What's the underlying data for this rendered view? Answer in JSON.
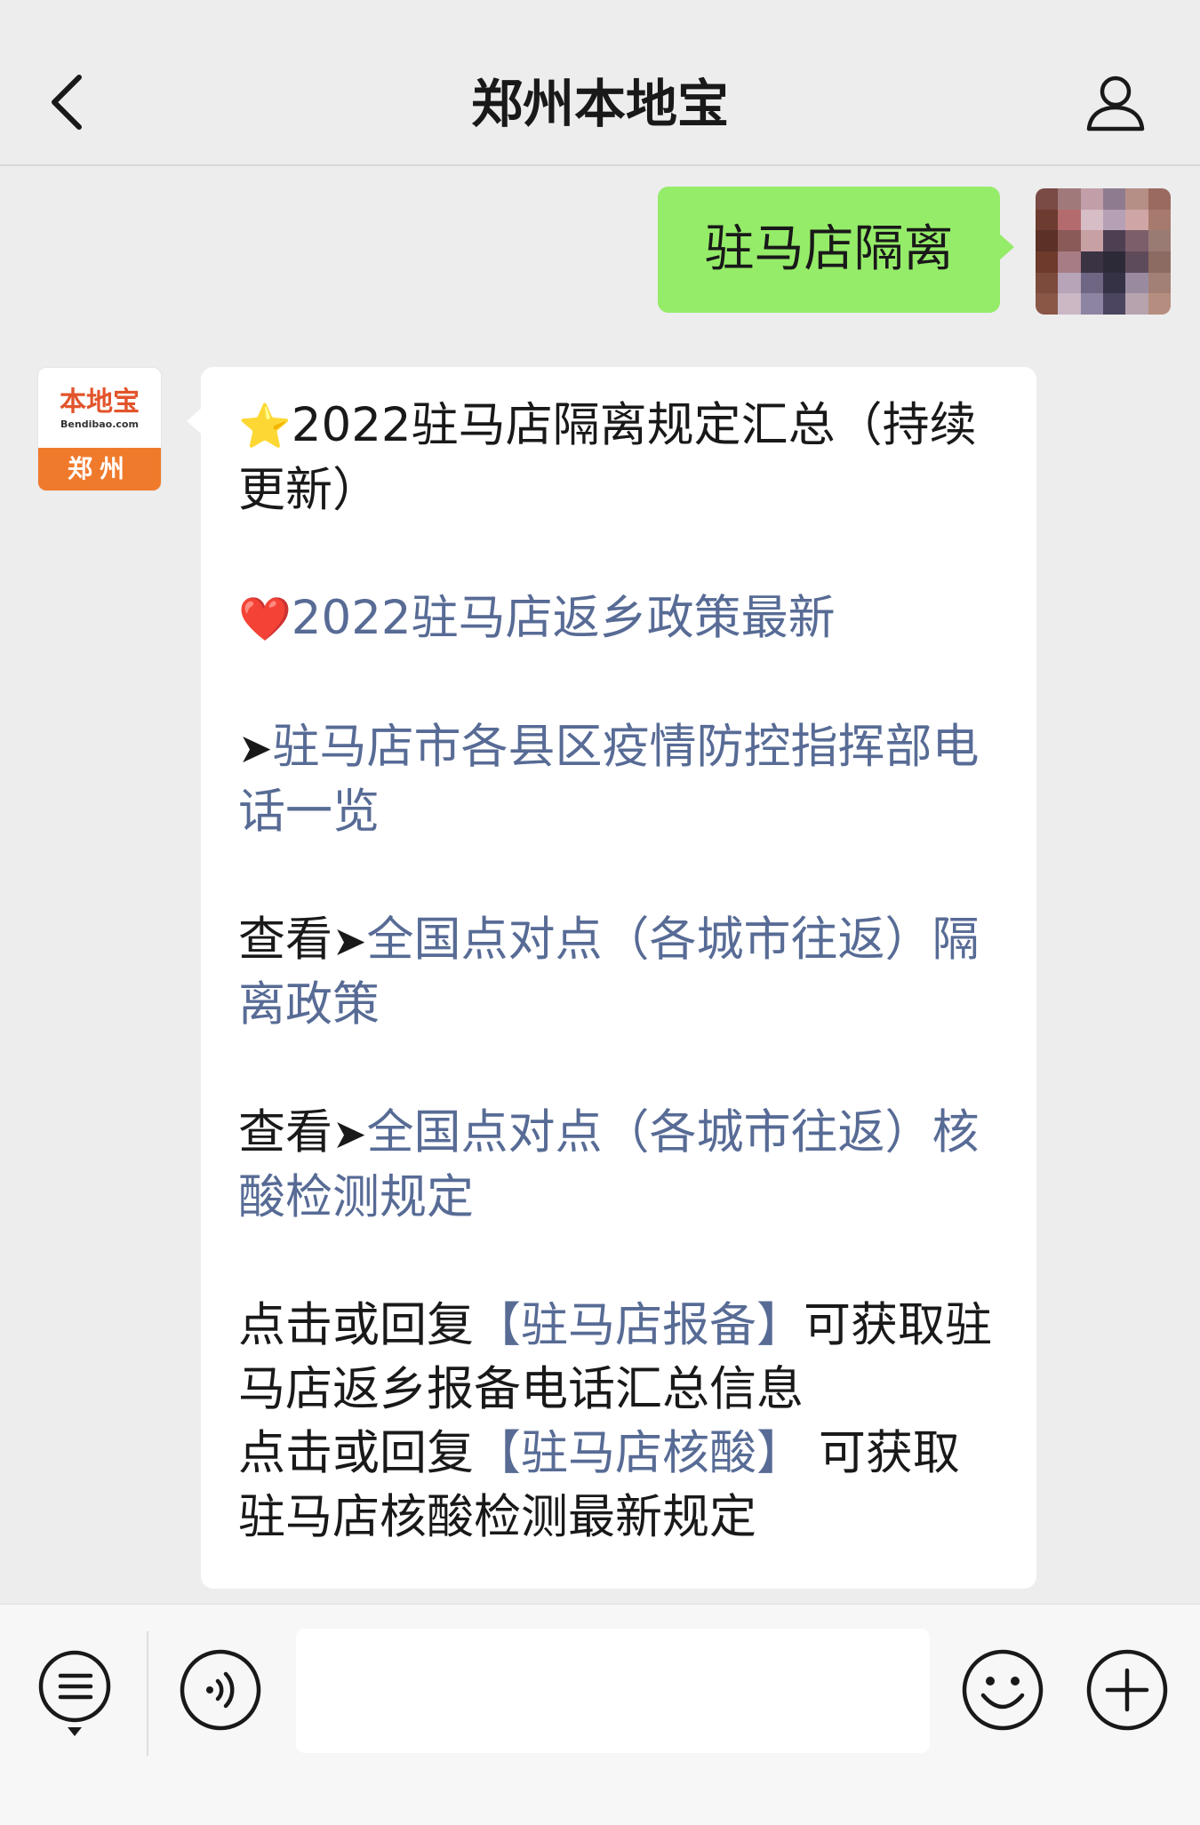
{
  "header": {
    "title": "郑州本地宝",
    "back_icon": "chevron-left-icon",
    "profile_icon": "person-icon"
  },
  "outgoing_message": {
    "text": "驻马店隔离"
  },
  "sender": {
    "avatar_brand": "本地宝",
    "avatar_sub": "Bendibao.com",
    "avatar_city": "郑州"
  },
  "incoming_message": {
    "item1": {
      "emoji": "⭐",
      "text": "2022驻马店隔离规定汇总（持续更新）"
    },
    "item2": {
      "emoji": "❤️",
      "text": "2022驻马店返乡政策最新"
    },
    "item3": {
      "arrow": "➤",
      "link": "驻马店市各县区疫情防控指挥部电话一览"
    },
    "item4": {
      "prefix": "查看",
      "arrow": "➤",
      "link": "全国点对点（各城市往返）隔离政策"
    },
    "item5": {
      "prefix": "查看",
      "arrow": "➤",
      "link": "全国点对点（各城市往返）核酸检测规定"
    },
    "item6": {
      "prefix": "点击或回复",
      "link": "【驻马店报备】",
      "suffix": "可获取驻马店返乡报备电话汇总信息"
    },
    "item7": {
      "prefix": "点击或回复",
      "link": "【驻马店核酸】",
      "suffix": " 可获取驻马店核酸检测最新规定"
    }
  },
  "input_bar": {
    "menu_icon": "list-menu-icon",
    "voice_icon": "voice-icon",
    "emoji_icon": "smiley-icon",
    "plus_icon": "plus-icon",
    "input_value": ""
  },
  "colors": {
    "background": "#ededed",
    "outgoing_bubble": "#95ec69",
    "link": "#576b95",
    "avatar_orange": "#f07a2c"
  }
}
